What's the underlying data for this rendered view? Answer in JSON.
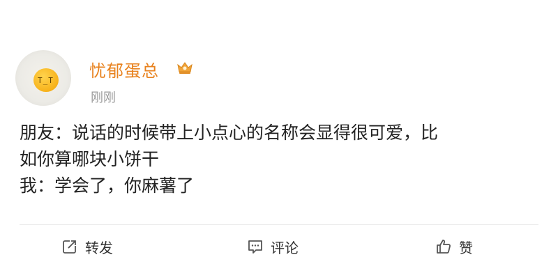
{
  "post": {
    "username": "忧郁蛋总",
    "timestamp": "刚刚",
    "avatar_icon": "fried-egg-avatar",
    "badge_icon": "vip-crown-icon",
    "accent_color": "#e8821e",
    "lines": [
      "朋友：说话的时候带上小点心的名称会显得很可爱，比",
      "如你算哪块小饼干",
      "我：学会了，你麻薯了"
    ]
  },
  "actions": {
    "repost_label": "转发",
    "comment_label": "评论",
    "like_label": "赞",
    "repost_icon": "share-icon",
    "comment_icon": "comment-icon",
    "like_icon": "thumbs-up-icon"
  }
}
